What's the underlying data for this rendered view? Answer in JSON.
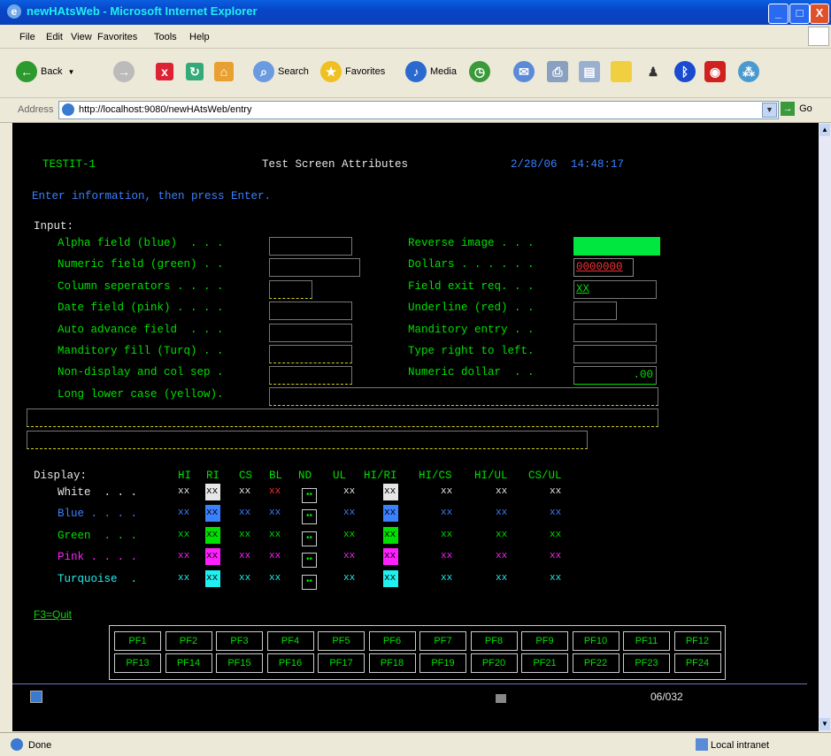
{
  "window": {
    "title": "newHAtsWeb - Microsoft Internet Explorer"
  },
  "menu": [
    "File",
    "Edit",
    "View",
    "Favorites",
    "Tools",
    "Help"
  ],
  "toolbar": {
    "back": "Back",
    "search": "Search",
    "favorites": "Favorites",
    "media": "Media"
  },
  "address": {
    "label": "Address",
    "url": "http://localhost:9080/newHAtsWeb/entry",
    "go": "Go"
  },
  "screen": {
    "id": "TESTIT-1",
    "title": "Test Screen Attributes",
    "date": "2/28/06",
    "time": "14:48:17",
    "instruction": "Enter information, then press Enter.",
    "input_heading": "Input:",
    "left_fields": [
      "Alpha field (blue)  . . .",
      "Numeric field (green) . .",
      "Column seperators . . . .",
      "Date field (pink) . . . .",
      "Auto advance field  . . .",
      "Manditory fill (Turq) . .",
      "Non-display and col sep .",
      "Long lower case (yellow)."
    ],
    "right_fields": [
      "Reverse image . . .",
      "Dollars . . . . . .",
      "Field exit req. . .",
      "Underline (red) . .",
      "Manditory entry . .",
      "Type right to left.",
      "Numeric dollar  . ."
    ],
    "right_values": {
      "dollars": "0000000",
      "field_exit": "XX",
      "numeric_dollar": ".00"
    },
    "display_heading": "Display:",
    "display_cols": [
      "HI",
      "RI",
      "CS",
      "BL",
      "ND",
      "UL",
      "HI/RI",
      "HI/CS",
      "HI/UL",
      "CS/UL"
    ],
    "display_rows": [
      "White  . . .",
      "Blue . . . .",
      "Green  . . .",
      "Pink . . . .",
      "Turquoise  ."
    ],
    "cell": "xx",
    "nd_glyph": "••",
    "quit": "F3=Quit",
    "status_pos": "06/032"
  },
  "pf_keys": [
    "PF1",
    "PF2",
    "PF3",
    "PF4",
    "PF5",
    "PF6",
    "PF7",
    "PF8",
    "PF9",
    "PF10",
    "PF11",
    "PF12",
    "PF13",
    "PF14",
    "PF15",
    "PF16",
    "PF17",
    "PF18",
    "PF19",
    "PF20",
    "PF21",
    "PF22",
    "PF23",
    "PF24"
  ],
  "status": {
    "left": "Done",
    "zone": "Local intranet"
  }
}
